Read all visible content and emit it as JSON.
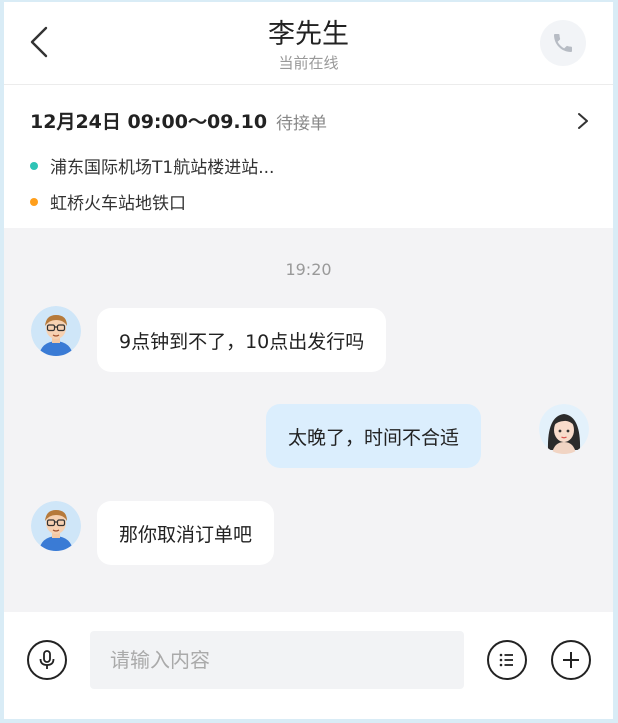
{
  "header": {
    "title": "李先生",
    "subtitle": "当前在线",
    "back_icon": "chevron-left-icon",
    "call_icon": "phone-icon"
  },
  "order": {
    "time": "12月24日 09:00～09.10",
    "status": "待接单",
    "start_location": "浦东国际机场T1航站楼进站...",
    "end_location": "虹桥火车站地铁口",
    "start_dot_color": "#2ec4b6",
    "end_dot_color": "#ff9f1c"
  },
  "chat": {
    "timestamp": "19:20",
    "messages": [
      {
        "sender": "driver",
        "text": "9点钟到不了，10点出发行吗"
      },
      {
        "sender": "me",
        "text": "太晚了，时间不合适"
      },
      {
        "sender": "driver",
        "text": "那你取消订单吧"
      }
    ]
  },
  "input": {
    "placeholder": "请输入内容",
    "value": "",
    "mic_icon": "microphone-icon",
    "list_icon": "list-icon",
    "plus_icon": "plus-icon"
  }
}
